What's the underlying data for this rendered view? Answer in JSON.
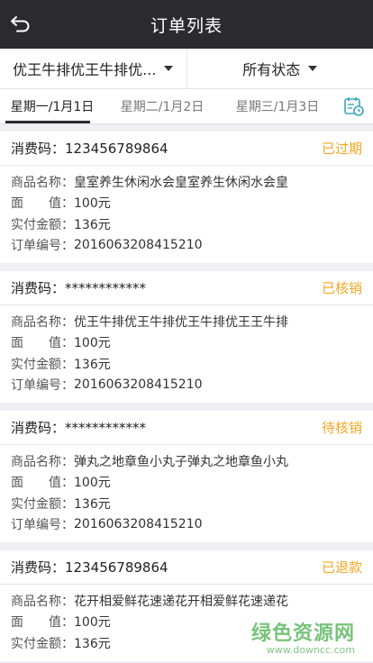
{
  "header": {
    "title": "订单列表",
    "back_icon": "back-arrow-icon"
  },
  "filters": {
    "merchant": "优王牛排优王牛排优...",
    "status": "所有状态"
  },
  "date_tabs": [
    {
      "label": "星期一/1月1日"
    },
    {
      "label": "星期二/1月2日"
    },
    {
      "label": "星期三/1月3日"
    }
  ],
  "calendar_icon": "calendar-clock-icon",
  "labels": {
    "code": "消费码：",
    "product": "商品名称：",
    "face_a": "面",
    "face_b": "值",
    "colon": "：",
    "paid": "实付金额：",
    "order": "订单编号："
  },
  "orders": [
    {
      "code": "123456789864",
      "status": "已过期",
      "product": "皇室养生休闲水会皇室养生休闲水会皇",
      "face_value": "100元",
      "paid": "136元",
      "order_no": "2016063208415210"
    },
    {
      "code": "************",
      "status": "已核销",
      "product": "优王牛排优王牛排优王牛排优王王牛排",
      "face_value": "100元",
      "paid": "136元",
      "order_no": "2016063208415210"
    },
    {
      "code": "************",
      "status": "待核销",
      "product": "弹丸之地章鱼小丸子弹丸之地章鱼小丸",
      "face_value": "100元",
      "paid": "136元",
      "order_no": "2016063208415210"
    },
    {
      "code": "123456789864",
      "status": "已退款",
      "product": "花开相爱鲜花速递花开相爱鲜花速递花",
      "face_value": "100元",
      "paid": "136元",
      "order_no": ""
    }
  ],
  "colors": {
    "header_bg": "#2b2b2f",
    "status": "#f5a623",
    "background": "#efeff4"
  },
  "watermark": {
    "main": "绿色资源网",
    "url": "www.downcc.com"
  }
}
